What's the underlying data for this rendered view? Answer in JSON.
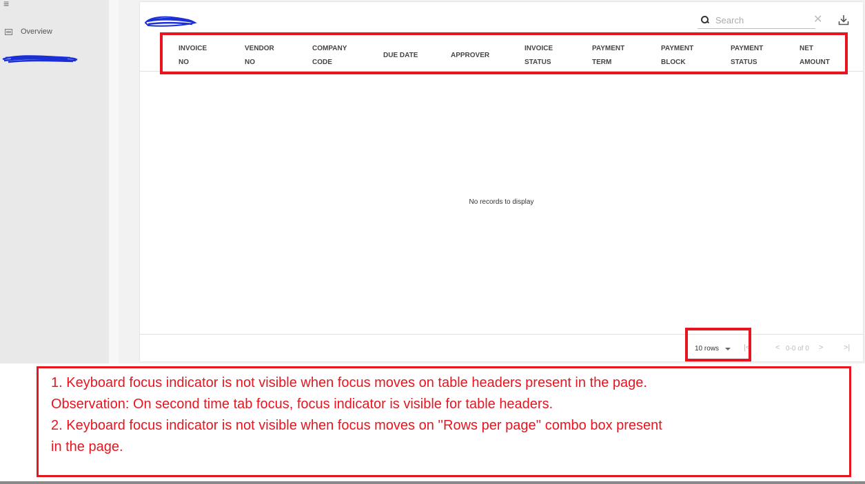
{
  "sidebar": {
    "menu_icon": "hamburger-menu-icon",
    "items": [
      {
        "label": "Overview",
        "icon": "table-icon"
      }
    ]
  },
  "toolbar": {
    "search_placeholder": "Search",
    "search_icon": "search-icon",
    "clear_icon": "close-icon",
    "download_icon": "download-icon"
  },
  "table": {
    "columns": [
      "INVOICE\nNO",
      "VENDOR\nNO",
      "COMPANY\nCODE",
      "DUE DATE",
      "APPROVER",
      "INVOICE\nSTATUS",
      "PAYMENT\nTERM",
      "PAYMENT\nBLOCK",
      "PAYMENT\nSTATUS",
      "NET\nAMOUNT"
    ],
    "empty_message": "No records to display"
  },
  "pagination": {
    "rows_per_page": "10 rows",
    "page_info": "0-0 of 0",
    "first_icon": "first-page-icon",
    "prev_icon": "chevron-left-icon",
    "next_icon": "chevron-right-icon",
    "last_icon": "last-page-icon"
  },
  "annotation": {
    "color": "#e8141f",
    "notes": [
      "1. Keyboard focus indicator is not visible when focus moves on table headers present in the page.",
      "Observation: On second time tab focus, focus indicator is visible for table headers.",
      "2. Keyboard focus indicator is not visible when focus moves on ''Rows per page'' combo box present",
      "in the page."
    ]
  }
}
